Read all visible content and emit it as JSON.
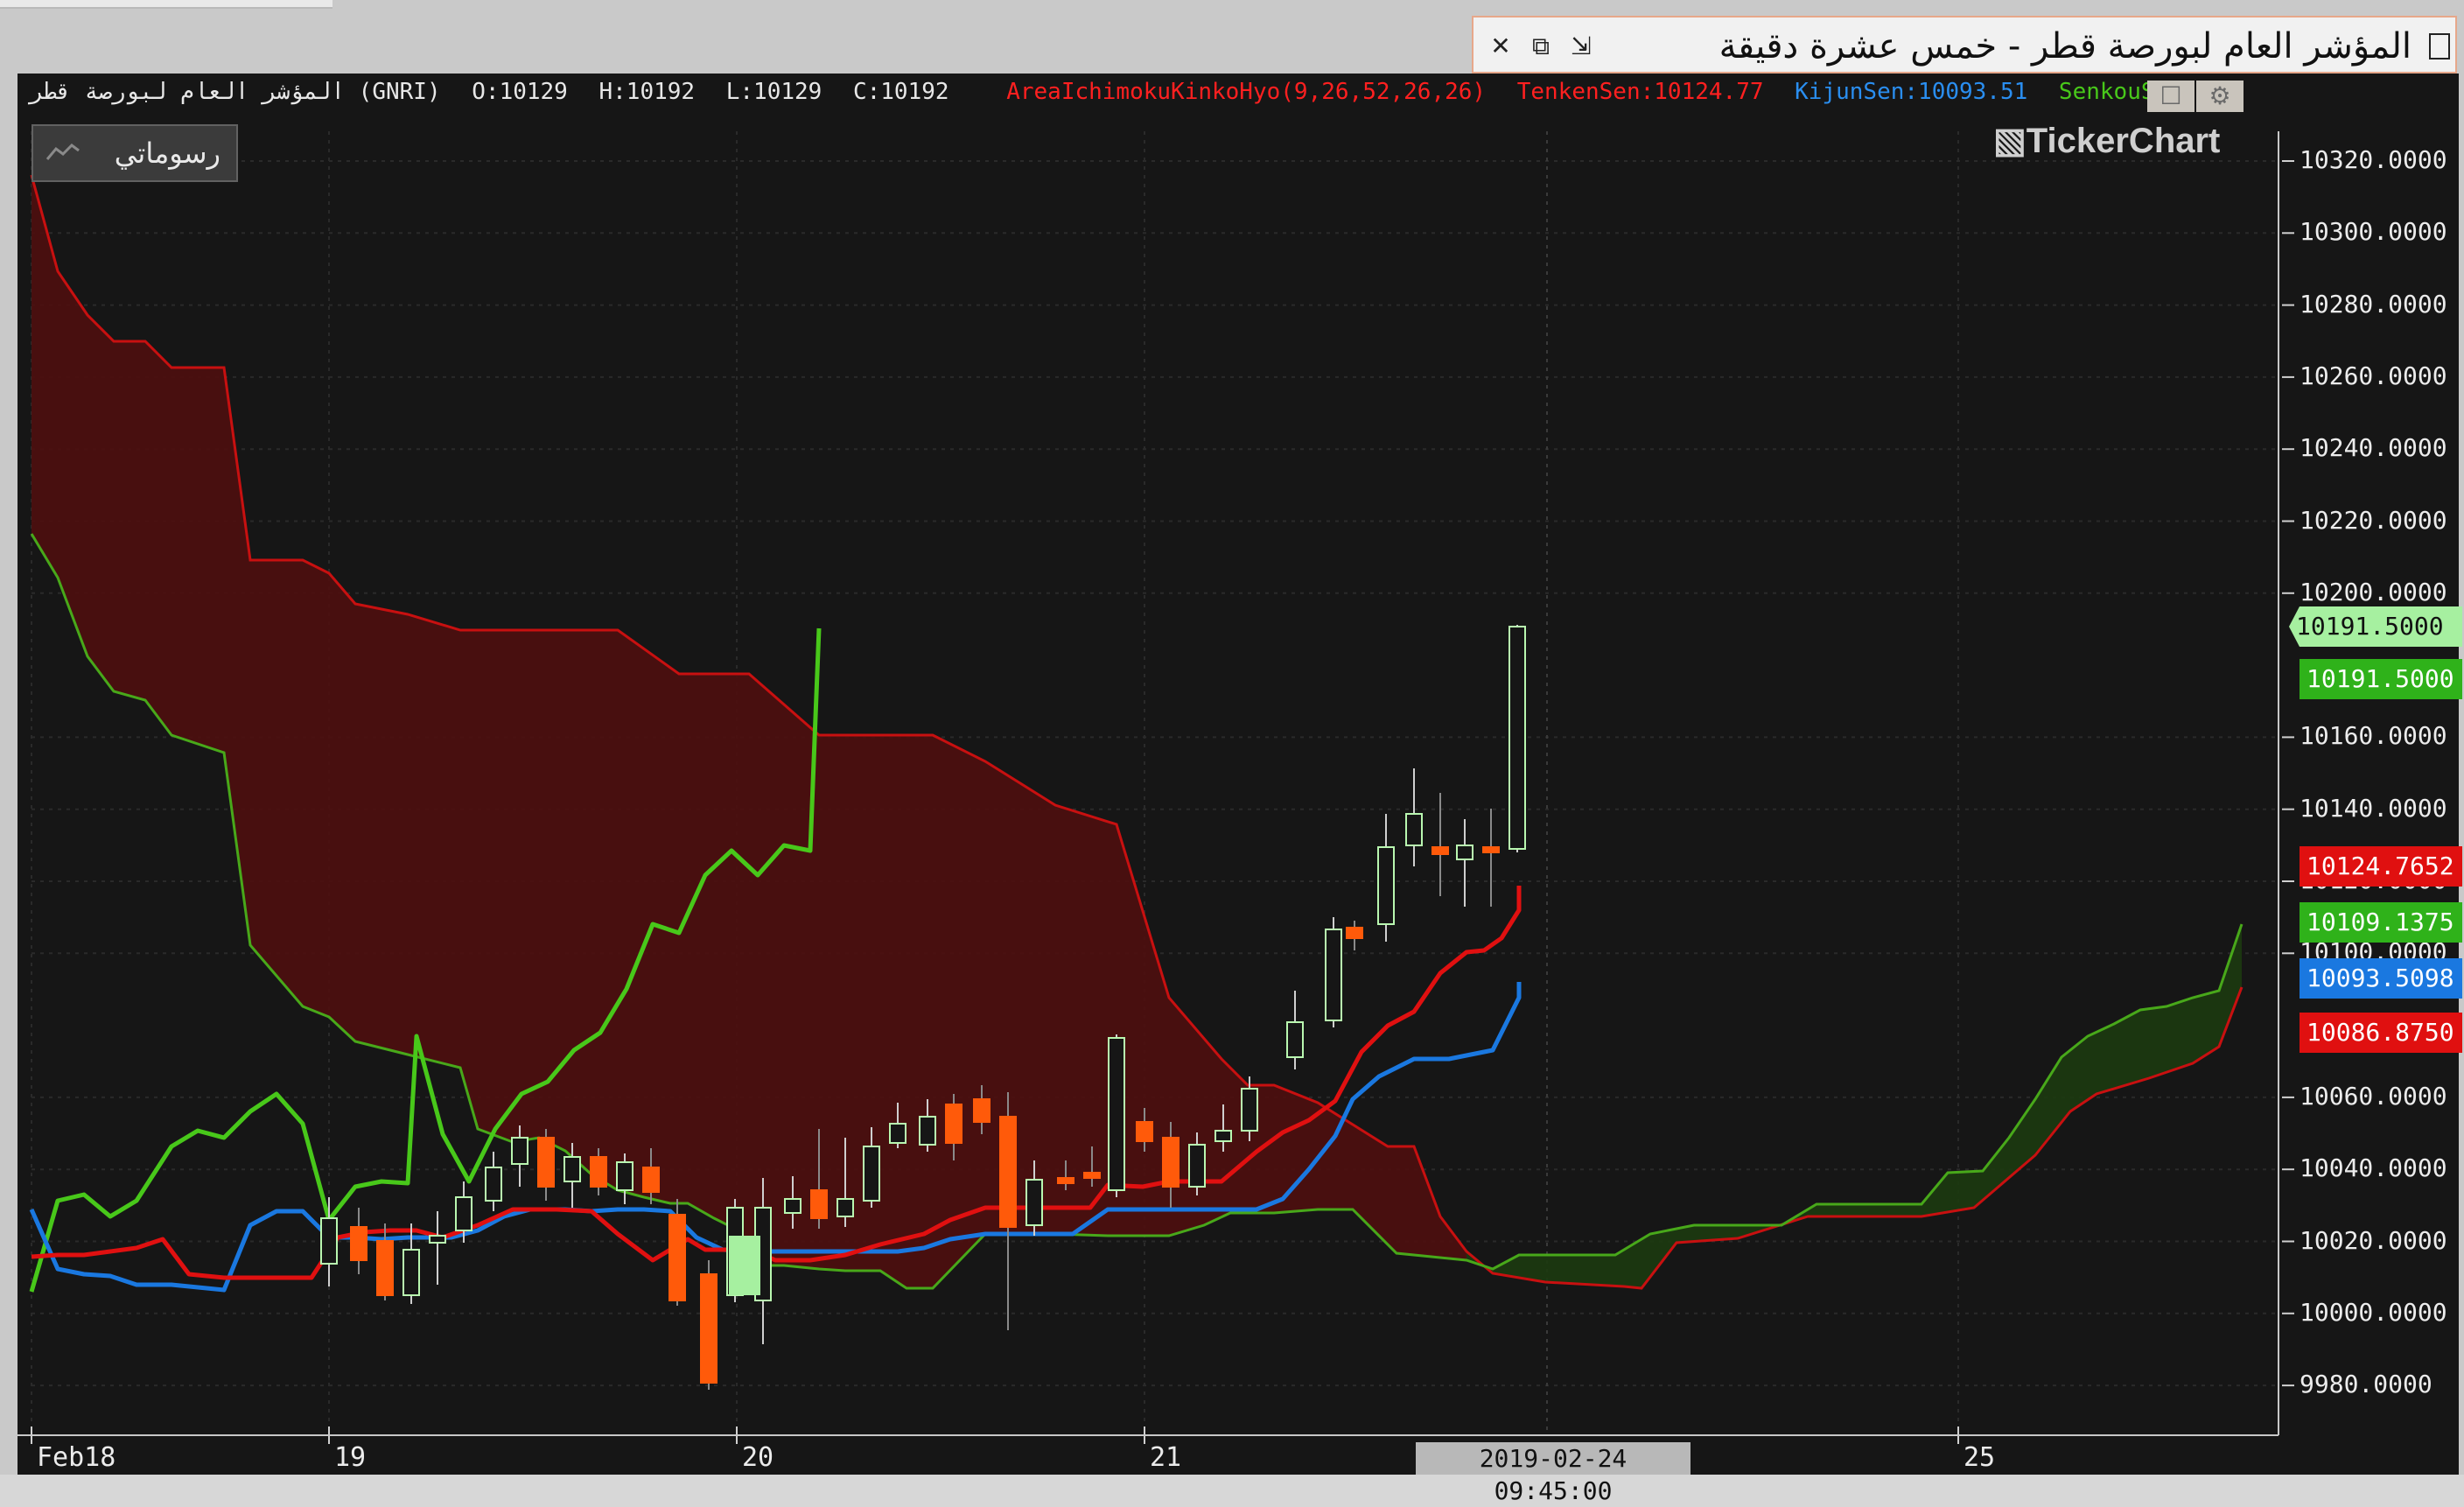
{
  "window": {
    "title": "المؤشر العام لبورصة قطر - خمس عشرة دقيقة"
  },
  "header": {
    "symbol": "المؤشر العام لبورصة قطر (GNRI)",
    "open": "O:10129",
    "high": "H:10192",
    "low": "L:10129",
    "close": "C:10192",
    "indicator": "AreaIchimokuKinkoHyo(9,26,52,26,26)",
    "tenkan": "TenkenSen:10124.77",
    "kijun": "KijunSen:10093.51",
    "senkou": "SenkouSpanA"
  },
  "toolbar": {
    "drawings_label": "رسوماتي",
    "brand": "TickerChart"
  },
  "y_axis": {
    "ticks": [
      "10320.0000",
      "10300.0000",
      "10280.0000",
      "10260.0000",
      "10240.0000",
      "10220.0000",
      "10200.0000",
      "10160.0000",
      "10140.0000",
      "10120.0000",
      "10100.0000",
      "10060.0000",
      "10040.0000",
      "10020.0000",
      "10000.0000",
      "9980.0000"
    ]
  },
  "x_axis": {
    "ticks": [
      "Feb18",
      "19",
      "20",
      "21",
      "25"
    ],
    "crosshair_date": "2019-02-24 09:45:00"
  },
  "price_tags": [
    {
      "text": "10191.5000",
      "bg": "#a6f0a0",
      "fg": "#111111"
    },
    {
      "text": "10191.5000",
      "bg": "#2fb21a",
      "fg": "#ffffff"
    },
    {
      "text": "10124.7652",
      "bg": "#e01010",
      "fg": "#ffffff"
    },
    {
      "text": "10109.1375",
      "bg": "#2fb21a",
      "fg": "#ffffff"
    },
    {
      "text": "10093.5098",
      "bg": "#1a78e0",
      "fg": "#ffffff"
    },
    {
      "text": "10086.8750",
      "bg": "#e01010",
      "fg": "#ffffff"
    }
  ],
  "colors": {
    "background": "#161616",
    "grid": "#2a2a2a",
    "tenkan": "#e01010",
    "kijun": "#1a78e0",
    "chikou": "#48c81a",
    "cloud_bear": "#4e0e0e",
    "cloud_bull": "#1c3a10",
    "span_a": "#48a81a",
    "span_b": "#c81010",
    "up_candle": "#b9f7b0",
    "down_candle": "#ff5a0a"
  }
}
